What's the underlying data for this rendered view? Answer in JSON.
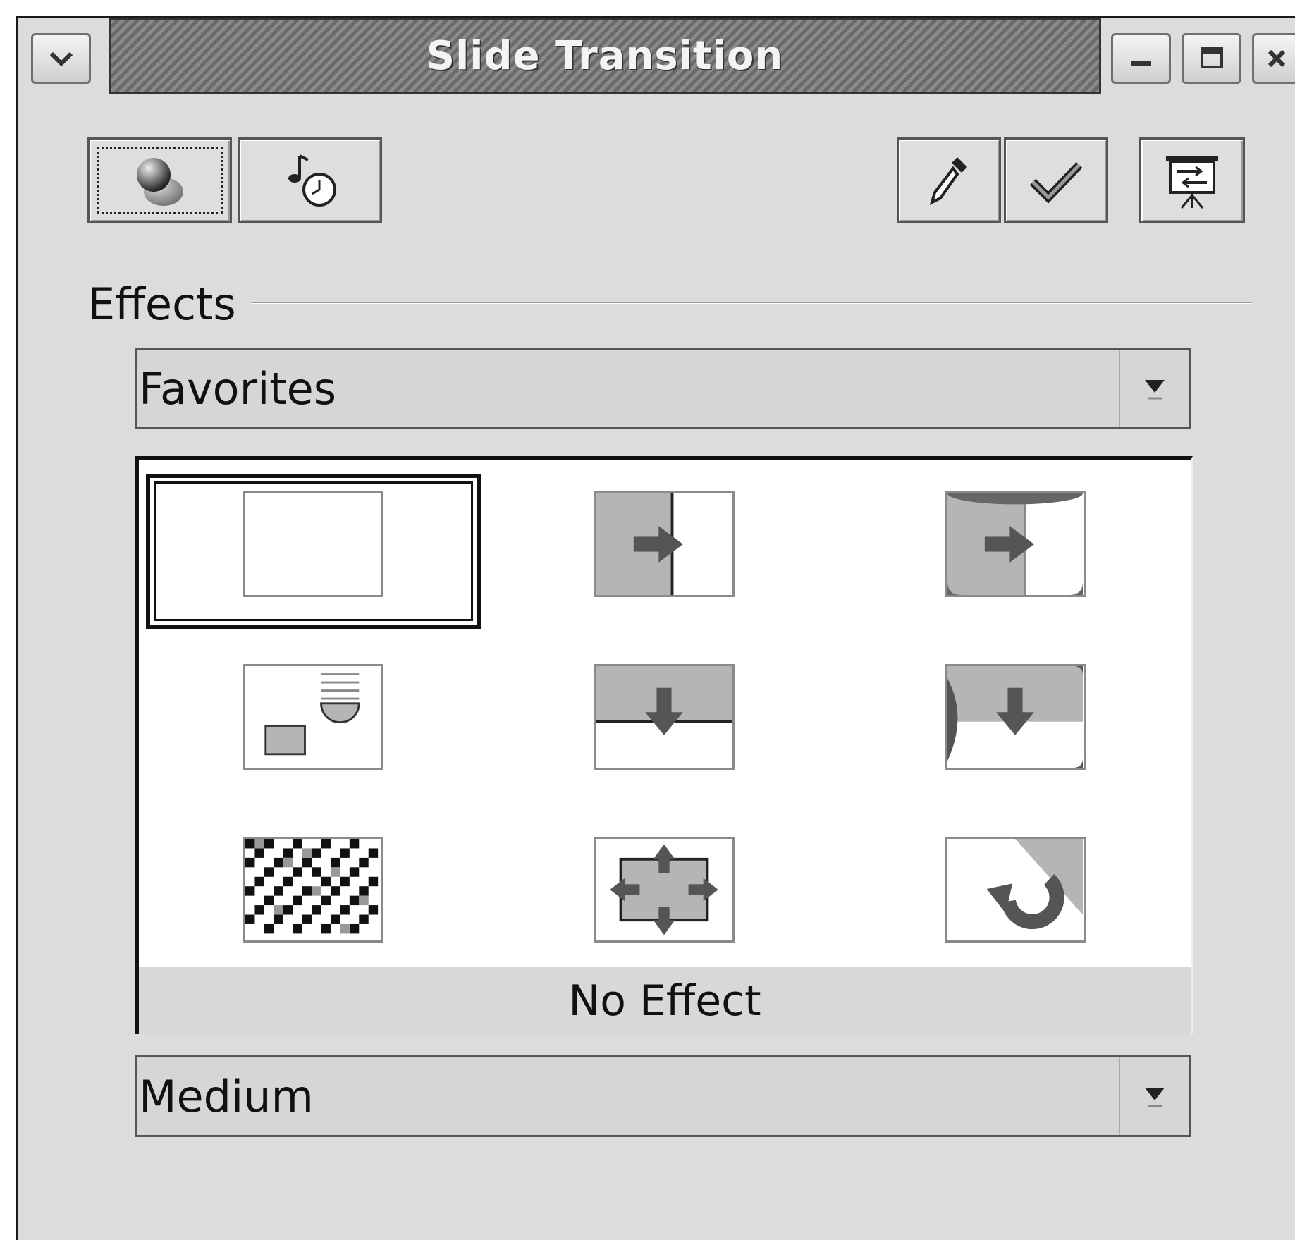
{
  "window": {
    "title": "Slide Transition",
    "controls": {
      "menu_icon": "chevron-down-icon",
      "minimize_icon": "minimize-icon",
      "maximize_icon": "maximize-icon",
      "close_icon": "close-icon"
    }
  },
  "toolbar": {
    "left": [
      {
        "icon": "effects-icon",
        "selected": true
      },
      {
        "icon": "sound-timing-icon",
        "selected": false
      }
    ],
    "right": [
      {
        "icon": "eyedropper-icon"
      },
      {
        "icon": "apply-checkmark-icon"
      },
      {
        "icon": "slideshow-play-icon"
      }
    ]
  },
  "effects": {
    "label": "Effects",
    "category": "Favorites",
    "tiles": [
      {
        "name": "no-effect",
        "selected": true
      },
      {
        "name": "wipe-right"
      },
      {
        "name": "uncover-right"
      },
      {
        "name": "roll-down-shapes"
      },
      {
        "name": "wipe-down"
      },
      {
        "name": "uncover-down"
      },
      {
        "name": "dissolve-checker"
      },
      {
        "name": "expand-out"
      },
      {
        "name": "rotate-in"
      }
    ],
    "selected_effect": "No Effect"
  },
  "speed": {
    "value": "Medium"
  },
  "colors": {
    "window_bg": "#dcdcdc",
    "title_bar": "#7a7a7a",
    "panel_bg": "#ffffff",
    "tile_fill": "#b5b5b5",
    "arrow_fill": "#555555"
  }
}
